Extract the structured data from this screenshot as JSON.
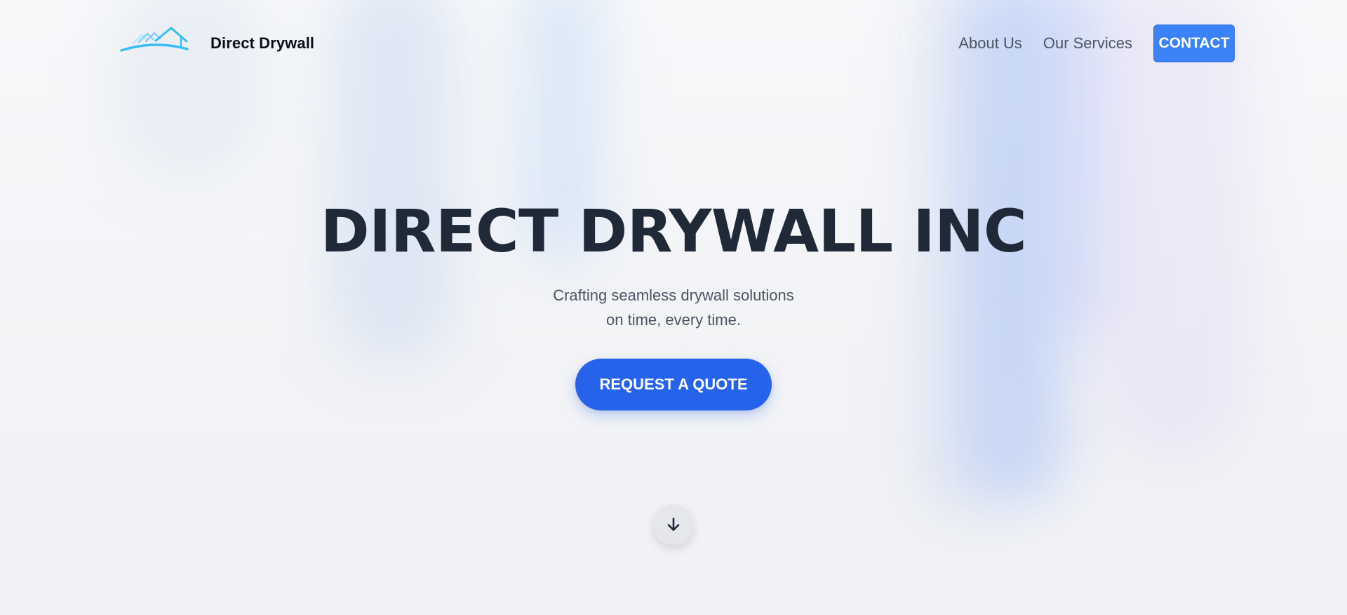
{
  "header": {
    "brand_name": "Direct Drywall",
    "logo_icon": "house-roof-logo-icon",
    "nav": [
      {
        "label": "About Us"
      },
      {
        "label": "Our Services"
      }
    ],
    "contact_label": "CONTACT"
  },
  "hero": {
    "title": "DIRECT DRYWALL INC",
    "subtitle_line1": "Crafting seamless drywall solutions",
    "subtitle_line2": "on time, every time.",
    "cta_label": "REQUEST A QUOTE"
  },
  "scroll": {
    "icon": "arrow-down-icon"
  },
  "colors": {
    "accent": "#2563eb",
    "contact_bg": "#3b82f6",
    "title": "#1f2937",
    "text_muted": "#4b5563",
    "logo": "#38bdf8"
  }
}
